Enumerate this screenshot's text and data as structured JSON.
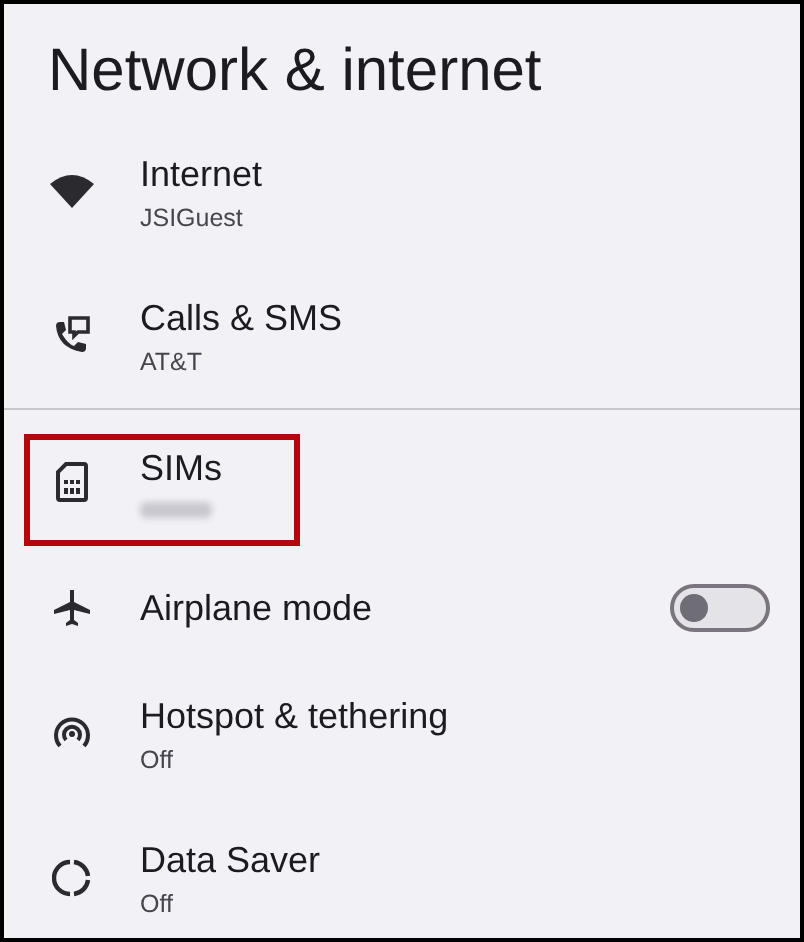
{
  "title": "Network & internet",
  "items": [
    {
      "kind": "link",
      "label": "Internet",
      "subtitle": "JSIGuest",
      "divider_before": false,
      "highlighted": false
    },
    {
      "kind": "link",
      "label": "Calls & SMS",
      "subtitle": "AT&T",
      "divider_before": false,
      "highlighted": false
    },
    {
      "kind": "link",
      "label": "SIMs",
      "redacted": true,
      "divider_before": true,
      "highlighted": true
    },
    {
      "kind": "toggle",
      "label": "Airplane mode",
      "on": false,
      "divider_before": false,
      "highlighted": false
    },
    {
      "kind": "link",
      "label": "Hotspot & tethering",
      "subtitle": "Off",
      "divider_before": false,
      "highlighted": false
    },
    {
      "kind": "link",
      "label": "Data Saver",
      "subtitle": "Off",
      "divider_before": false,
      "highlighted": false
    }
  ]
}
